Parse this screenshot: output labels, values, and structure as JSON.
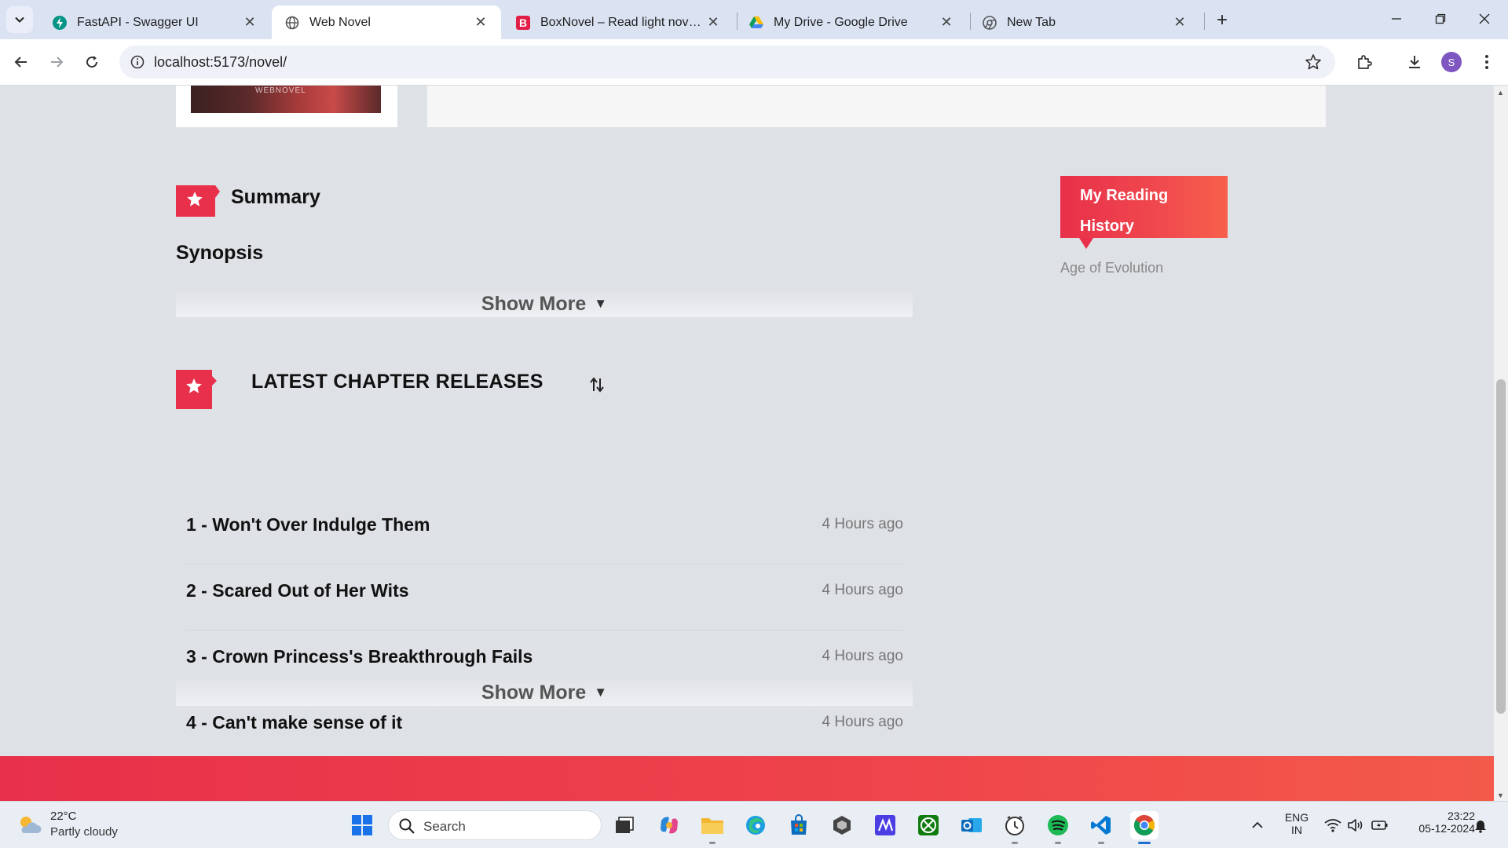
{
  "browser": {
    "tabs": [
      {
        "title": "FastAPI - Swagger UI",
        "active": false
      },
      {
        "title": "Web Novel",
        "active": true
      },
      {
        "title": "BoxNovel – Read light novel, korean novel",
        "active": false
      },
      {
        "title": "My Drive - Google Drive",
        "active": false
      },
      {
        "title": "New Tab",
        "active": false
      }
    ],
    "url": "localhost:5173/novel/",
    "profile_initial": "S"
  },
  "page": {
    "cover_watermark": "WEBNOVEL",
    "summary_heading": "Summary",
    "synopsis_heading": "Synopsis",
    "show_more_label": "Show More",
    "latest_heading": "LATEST CHAPTER RELEASES",
    "chapters": [
      {
        "title": "1 - Won't Over Indulge Them",
        "time": "4 Hours ago"
      },
      {
        "title": "2 - Scared Out of Her Wits",
        "time": "4 Hours ago"
      },
      {
        "title": "3 - Crown Princess's Breakthrough Fails",
        "time": "4 Hours ago"
      },
      {
        "title": "4 - Can't make sense of it",
        "time": "4 Hours ago"
      }
    ],
    "reading_history": {
      "line1": "My Reading",
      "line2": "History",
      "items": [
        "Age of Evolution"
      ]
    },
    "accent_color": "#e8304a"
  },
  "taskbar": {
    "weather_temp": "22°C",
    "weather_desc": "Partly cloudy",
    "search_placeholder": "Search",
    "lang_line1": "ENG",
    "lang_line2": "IN",
    "time": "23:22",
    "date": "05-12-2024"
  }
}
